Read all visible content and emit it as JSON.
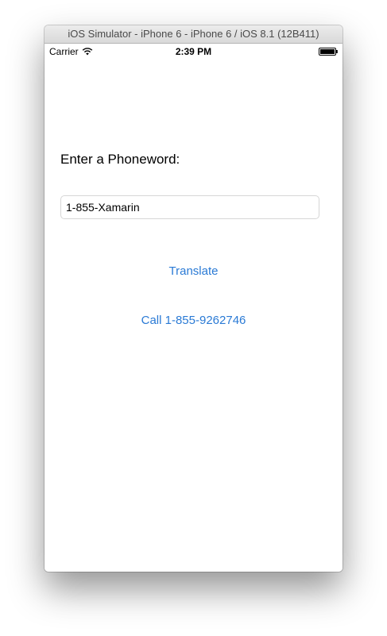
{
  "window": {
    "title": "iOS Simulator - iPhone 6 - iPhone 6 / iOS 8.1 (12B411)"
  },
  "statusbar": {
    "carrier": "Carrier",
    "time": "2:39 PM",
    "wifi_icon": "wifi-icon",
    "battery_icon": "battery-full-icon",
    "battery_level": 1.0
  },
  "main": {
    "prompt": "Enter a Phoneword:",
    "phone_value": "1-855-Xamarin",
    "translate_label": "Translate",
    "call_label": "Call 1-855-9262746"
  },
  "colors": {
    "tint": "#2a7ad5",
    "text": "#000000",
    "field_border": "#d6d6d6"
  }
}
